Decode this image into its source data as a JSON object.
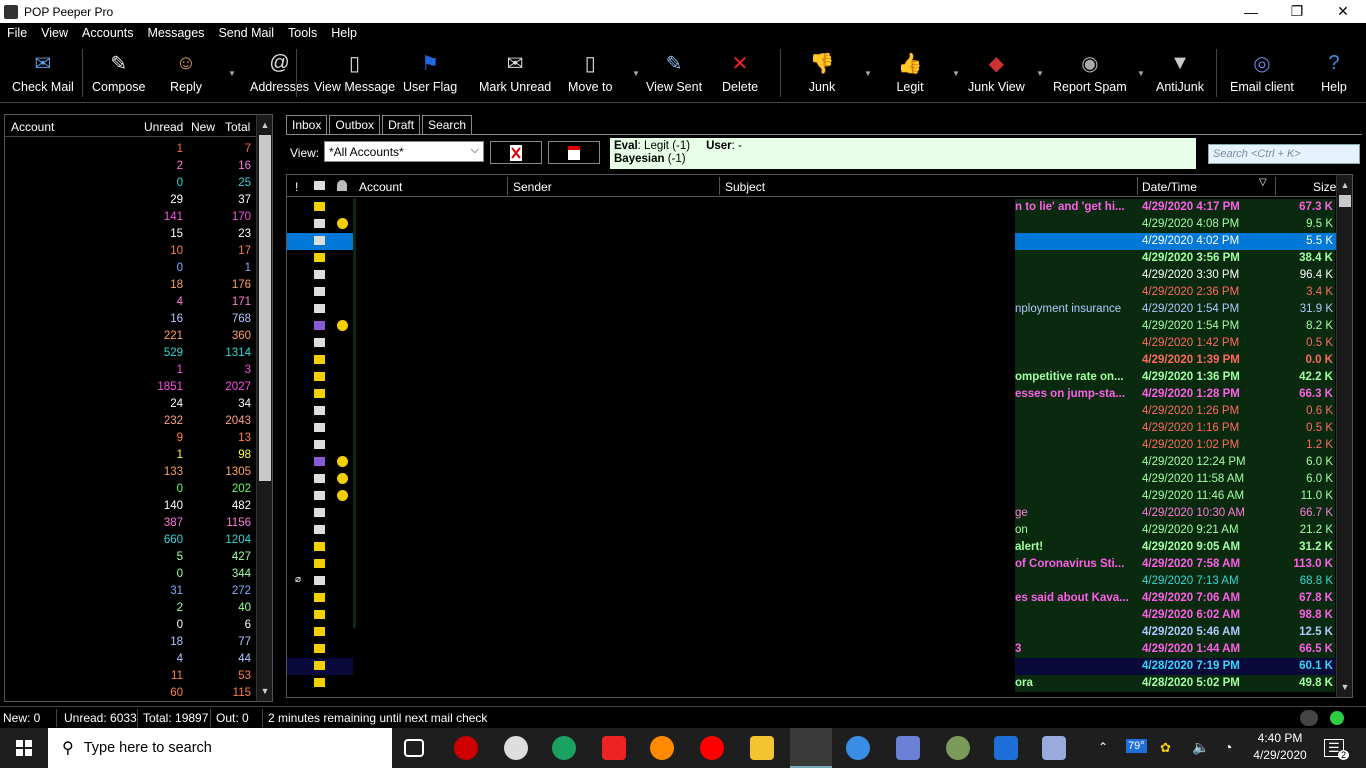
{
  "window": {
    "title": "POP Peeper Pro",
    "minimize": "—",
    "restore": "❐",
    "close": "✕"
  },
  "menu": [
    "File",
    "View",
    "Accounts",
    "Messages",
    "Send Mail",
    "Tools",
    "Help"
  ],
  "toolbar": [
    {
      "label": "Check Mail",
      "icon": "check-mail-icon",
      "glyph": "✉"
    },
    {
      "label": "Compose",
      "icon": "compose-icon",
      "glyph": "✎"
    },
    {
      "label": "Reply",
      "icon": "reply-icon",
      "glyph": "☺"
    },
    {
      "label": "Addresses",
      "icon": "addresses-icon",
      "glyph": "@"
    },
    {
      "label": "View Message",
      "icon": "view-message-icon",
      "glyph": "▯"
    },
    {
      "label": "User Flag",
      "icon": "user-flag-icon",
      "glyph": "⚑"
    },
    {
      "label": "Mark Unread",
      "icon": "mark-unread-icon",
      "glyph": "✉"
    },
    {
      "label": "Move to",
      "icon": "move-to-icon",
      "glyph": "▯"
    },
    {
      "label": "View Sent",
      "icon": "view-sent-icon",
      "glyph": "✎"
    },
    {
      "label": "Delete",
      "icon": "delete-icon",
      "glyph": "✕"
    },
    {
      "label": "Junk",
      "icon": "thumbs-down-icon",
      "glyph": "👎"
    },
    {
      "label": "Legit",
      "icon": "thumbs-up-icon",
      "glyph": "👍"
    },
    {
      "label": "Junk View",
      "icon": "junk-view-icon",
      "glyph": "◆"
    },
    {
      "label": "Report Spam",
      "icon": "report-spam-icon",
      "glyph": "◉"
    },
    {
      "label": "AntiJunk",
      "icon": "funnel-icon",
      "glyph": "▼"
    },
    {
      "label": "Email client",
      "icon": "email-client-icon",
      "glyph": "◎"
    },
    {
      "label": "Help",
      "icon": "help-icon",
      "glyph": "?"
    }
  ],
  "accounts": {
    "headers": {
      "account": "Account",
      "unread": "Unread",
      "new": "New",
      "total": "Total"
    },
    "rows": [
      {
        "unread": "1",
        "total": "7",
        "color": "#ff6a3d"
      },
      {
        "unread": "2",
        "total": "16",
        "color": "#ff7ad9"
      },
      {
        "unread": "0",
        "total": "25",
        "color": "#33d6d6"
      },
      {
        "unread": "29",
        "total": "37",
        "color": "#ffffff"
      },
      {
        "unread": "141",
        "total": "170",
        "color": "#ff4fe3"
      },
      {
        "unread": "15",
        "total": "23",
        "color": "#ffffff"
      },
      {
        "unread": "10",
        "total": "17",
        "color": "#ff8040"
      },
      {
        "unread": "0",
        "total": "1",
        "color": "#7fb0ff"
      },
      {
        "unread": "18",
        "total": "176",
        "color": "#ffa060"
      },
      {
        "unread": "4",
        "total": "171",
        "color": "#ff7ad9"
      },
      {
        "unread": "16",
        "total": "768",
        "color": "#b0c8ff"
      },
      {
        "unread": "221",
        "total": "360",
        "color": "#ffa060"
      },
      {
        "unread": "529",
        "total": "1314",
        "color": "#33d6d6"
      },
      {
        "unread": "1",
        "total": "3",
        "color": "#ff4fe3"
      },
      {
        "unread": "1851",
        "total": "2027",
        "color": "#ff4fe3"
      },
      {
        "unread": "24",
        "total": "34",
        "color": "#ffffff"
      },
      {
        "unread": "232",
        "total": "2043",
        "color": "#ff9a8a"
      },
      {
        "unread": "9",
        "total": "13",
        "color": "#ff8040"
      },
      {
        "unread": "1",
        "total": "98",
        "color": "#ffff40"
      },
      {
        "unread": "133",
        "total": "1305",
        "color": "#ffa060"
      },
      {
        "unread": "0",
        "total": "202",
        "color": "#5cff5c"
      },
      {
        "unread": "140",
        "total": "482",
        "color": "#ffffff"
      },
      {
        "unread": "387",
        "total": "1156",
        "color": "#ff7ad9"
      },
      {
        "unread": "660",
        "total": "1204",
        "color": "#33d6d6"
      },
      {
        "unread": "5",
        "total": "427",
        "color": "#a0ffa0"
      },
      {
        "unread": "0",
        "total": "344",
        "color": "#a0ffa0"
      },
      {
        "unread": "31",
        "total": "272",
        "color": "#7fb0ff"
      },
      {
        "unread": "2",
        "total": "40",
        "color": "#a0ffa0"
      },
      {
        "unread": "0",
        "total": "6",
        "color": "#ffffff"
      },
      {
        "unread": "18",
        "total": "77",
        "color": "#b0c8ff"
      },
      {
        "unread": "4",
        "total": "44",
        "color": "#b0c8ff"
      },
      {
        "unread": "11",
        "total": "53",
        "color": "#ff8040"
      },
      {
        "unread": "60",
        "total": "115",
        "color": "#ff8040"
      }
    ]
  },
  "tabs": [
    "Inbox",
    "Outbox",
    "Draft",
    "Search"
  ],
  "filter": {
    "view_label": "View:",
    "view_value": "*All Accounts*",
    "eval_text": "Eval",
    "eval_value": ": Legit (-1)",
    "user_label": "User",
    "user_value": ": -",
    "bayesian_label": "Bayesian",
    "bayesian_value": " (-1)",
    "search_placeholder": "Search <Ctrl + K>"
  },
  "columns": {
    "flag": "!",
    "account": "Account",
    "sender": "Sender",
    "subject": "Subject",
    "datetime": "Date/Time",
    "size": "Size"
  },
  "messages": [
    {
      "icon": "env",
      "smile": false,
      "subject": "n to lie' and 'get hi...",
      "date": "4/29/2020 4:17 PM",
      "size": "67.3 K",
      "color": "#ff5fe8",
      "bold": true
    },
    {
      "icon": "open",
      "smile": true,
      "subject": "",
      "date": "4/29/2020 4:08 PM",
      "size": "9.5 K",
      "color": "#a0ffa0",
      "bold": false
    },
    {
      "icon": "open",
      "smile": false,
      "subject": "",
      "date": "4/29/2020 4:02 PM",
      "size": "5.5 K",
      "color": "#ffffff",
      "bold": false,
      "selected": true
    },
    {
      "icon": "env",
      "smile": false,
      "subject": "",
      "date": "4/29/2020 3:56 PM",
      "size": "38.4 K",
      "color": "#a0ffa0",
      "bold": true
    },
    {
      "icon": "open",
      "smile": false,
      "subject": "",
      "date": "4/29/2020 3:30 PM",
      "size": "96.4 K",
      "color": "#ffffff",
      "bold": false
    },
    {
      "icon": "open",
      "smile": false,
      "subject": "",
      "date": "4/29/2020 2:36 PM",
      "size": "3.4 K",
      "color": "#ff6a5a",
      "bold": false
    },
    {
      "icon": "open",
      "smile": false,
      "subject": "nployment insurance",
      "date": "4/29/2020 1:54 PM",
      "size": "31.9 K",
      "color": "#b0c8ff",
      "bold": false
    },
    {
      "icon": "purple",
      "smile": true,
      "subject": "",
      "date": "4/29/2020 1:54 PM",
      "size": "8.2 K",
      "color": "#a0ffa0",
      "bold": false
    },
    {
      "icon": "open",
      "smile": false,
      "subject": "",
      "date": "4/29/2020 1:42 PM",
      "size": "0.5 K",
      "color": "#ff6a5a",
      "bold": false
    },
    {
      "icon": "env",
      "smile": false,
      "subject": "",
      "date": "4/29/2020 1:39 PM",
      "size": "0.0 K",
      "color": "#ff6a5a",
      "bold": true
    },
    {
      "icon": "env",
      "smile": false,
      "subject": "ompetitive rate on...",
      "date": "4/29/2020 1:36 PM",
      "size": "42.2 K",
      "color": "#a0ffa0",
      "bold": true
    },
    {
      "icon": "env",
      "smile": false,
      "subject": "esses on jump-sta...",
      "date": "4/29/2020 1:28 PM",
      "size": "66.3 K",
      "color": "#ff5fe8",
      "bold": true
    },
    {
      "icon": "open",
      "smile": false,
      "subject": "",
      "date": "4/29/2020 1:26 PM",
      "size": "0.6 K",
      "color": "#ff6a5a",
      "bold": false
    },
    {
      "icon": "open",
      "smile": false,
      "subject": "",
      "date": "4/29/2020 1:16 PM",
      "size": "0.5 K",
      "color": "#ff6a5a",
      "bold": false
    },
    {
      "icon": "open",
      "smile": false,
      "subject": "",
      "date": "4/29/2020 1:02 PM",
      "size": "1.2 K",
      "color": "#ff6a5a",
      "bold": false
    },
    {
      "icon": "purple",
      "smile": true,
      "subject": "",
      "date": "4/29/2020 12:24 PM",
      "size": "6.0 K",
      "color": "#a0ffa0",
      "bold": false
    },
    {
      "icon": "open",
      "smile": true,
      "subject": "",
      "date": "4/29/2020 11:58 AM",
      "size": "6.0 K",
      "color": "#a0ffa0",
      "bold": false
    },
    {
      "icon": "open",
      "smile": true,
      "subject": "",
      "date": "4/29/2020 11:46 AM",
      "size": "11.0 K",
      "color": "#a0ffa0",
      "bold": false
    },
    {
      "icon": "open",
      "smile": false,
      "subject": "ge",
      "date": "4/29/2020 10:30 AM",
      "size": "66.7 K",
      "color": "#ff7ad9",
      "bold": false
    },
    {
      "icon": "open",
      "smile": false,
      "subject": "on",
      "date": "4/29/2020 9:21 AM",
      "size": "21.2 K",
      "color": "#a0ffa0",
      "bold": false
    },
    {
      "icon": "env",
      "smile": false,
      "subject": "alert!",
      "date": "4/29/2020 9:05 AM",
      "size": "31.2 K",
      "color": "#a0ffa0",
      "bold": true
    },
    {
      "icon": "env",
      "smile": false,
      "subject": "of Coronavirus Sti...",
      "date": "4/29/2020 7:58 AM",
      "size": "113.0 K",
      "color": "#ff5fe8",
      "bold": true
    },
    {
      "icon": "open",
      "smile": false,
      "subject": "",
      "date": "4/29/2020 7:13 AM",
      "size": "68.8 K",
      "color": "#33d6d6",
      "bold": false,
      "clip": true
    },
    {
      "icon": "env",
      "smile": false,
      "subject": "es said about Kava...",
      "date": "4/29/2020 7:06 AM",
      "size": "67.8 K",
      "color": "#ff5fe8",
      "bold": true
    },
    {
      "icon": "env",
      "smile": false,
      "subject": "",
      "date": "4/29/2020 6:02 AM",
      "size": "98.8 K",
      "color": "#ff5fe8",
      "bold": true
    },
    {
      "icon": "env",
      "smile": false,
      "subject": "",
      "date": "4/29/2020 5:46 AM",
      "size": "12.5 K",
      "color": "#b0c8ff",
      "bold": true
    },
    {
      "icon": "env",
      "smile": false,
      "subject": "3",
      "date": "4/29/2020 1:44 AM",
      "size": "66.5 K",
      "color": "#ff5fe8",
      "bold": true
    },
    {
      "icon": "env",
      "smile": false,
      "subject": "",
      "date": "4/28/2020 7:19 PM",
      "size": "60.1 K",
      "color": "#33d6ff",
      "bold": true,
      "dark": true
    },
    {
      "icon": "env",
      "smile": false,
      "subject": "ora",
      "date": "4/28/2020 5:02 PM",
      "size": "49.8 K",
      "color": "#a0ffa0",
      "bold": true
    }
  ],
  "status": {
    "new": "New: 0",
    "unread": "Unread: 6033",
    "total": "Total: 19897",
    "out": "Out: 0",
    "message": "2 minutes remaining until next mail check"
  },
  "taskbar": {
    "search_placeholder": "Type here to search",
    "temperature": "79°",
    "time": "4:40 PM",
    "date": "4/29/2020",
    "notifications": "2"
  }
}
